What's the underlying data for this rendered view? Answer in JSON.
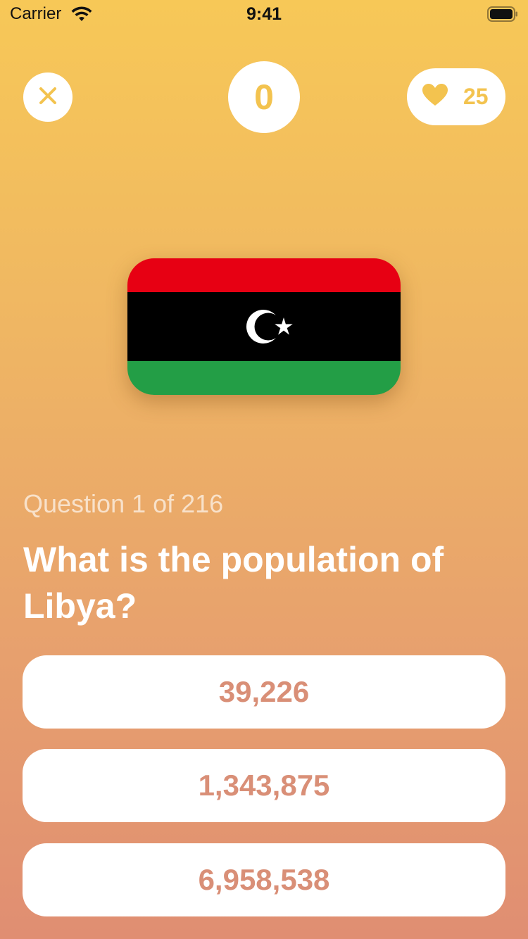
{
  "status_bar": {
    "carrier": "Carrier",
    "time": "9:41",
    "icons": [
      "wifi-icon",
      "battery-icon"
    ]
  },
  "header": {
    "close_icon": "close-icon",
    "score": "0",
    "lives_icon": "heart-icon",
    "lives": "25"
  },
  "flag": {
    "country": "Libya",
    "colors": {
      "red": "#e70013",
      "black": "#000000",
      "green": "#239e46",
      "emblem": "#ffffff"
    }
  },
  "question": {
    "counter": "Question 1 of 216",
    "text": "What is the population of Libya?"
  },
  "answers": [
    {
      "label": "39,226"
    },
    {
      "label": "1,343,875"
    },
    {
      "label": "6,958,538"
    }
  ],
  "colors": {
    "accent": "#f3c34f",
    "answer_text": "#d98f77",
    "gradient_top": "#f7c857",
    "gradient_bottom": "#e08e72"
  }
}
